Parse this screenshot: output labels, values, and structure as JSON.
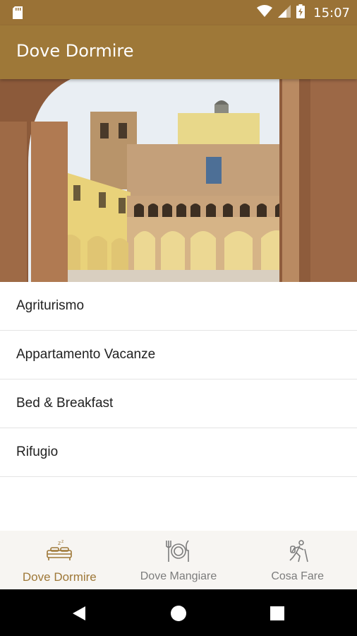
{
  "status_bar": {
    "time": "15:07",
    "icons": [
      "sd-card-icon",
      "wifi-icon",
      "signal-icon",
      "battery-charging-icon"
    ]
  },
  "app_bar": {
    "title": "Dove Dormire"
  },
  "hero": {
    "image": "monastery-cloister-photo"
  },
  "categories": [
    {
      "label": "Agriturismo"
    },
    {
      "label": "Appartamento Vacanze"
    },
    {
      "label": "Bed & Breakfast"
    },
    {
      "label": "Rifugio"
    }
  ],
  "bottom_nav": {
    "items": [
      {
        "label": "Dove Dormire",
        "icon": "bed-icon",
        "active": true
      },
      {
        "label": "Dove Mangiare",
        "icon": "cutlery-plate-icon",
        "active": false
      },
      {
        "label": "Cosa Fare",
        "icon": "hiker-icon",
        "active": false
      }
    ]
  },
  "colors": {
    "primary": "#9e7838",
    "status_bar": "#9a7236",
    "active_nav": "#9e7838",
    "inactive_nav": "#7c7c7c"
  }
}
